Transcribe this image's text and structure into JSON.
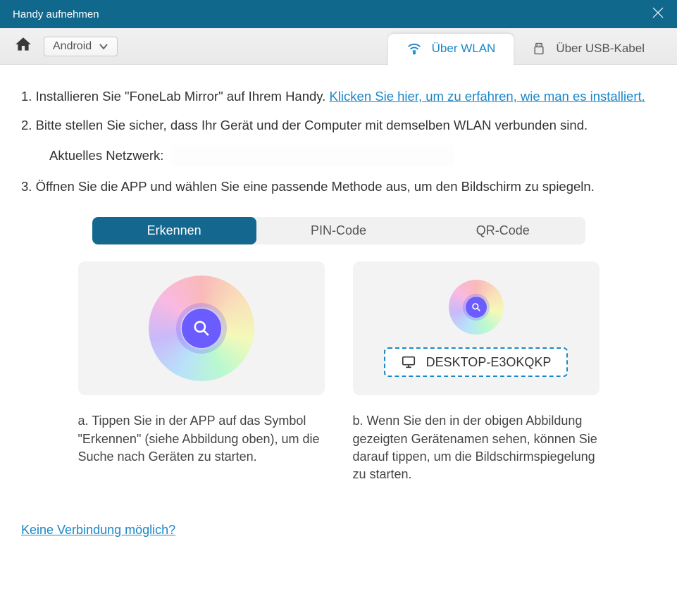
{
  "titlebar": {
    "title": "Handy aufnehmen"
  },
  "platform": {
    "selected": "Android"
  },
  "conn_tabs": {
    "wlan": "Über WLAN",
    "usb": "Über USB-Kabel"
  },
  "instructions": {
    "step1_prefix": "1. Installieren Sie \"FoneLab Mirror\" auf Ihrem Handy. ",
    "step1_link": "Klicken Sie hier, um zu erfahren, wie man es installiert.",
    "step2": "2. Bitte stellen Sie sicher, dass Ihr Gerät und der Computer mit demselben WLAN verbunden sind.",
    "network_label": "Aktuelles Netzwerk:",
    "step3": "3. Öffnen Sie die APP und wählen Sie eine passende Methode aus, um den Bildschirm zu spiegeln."
  },
  "method_tabs": {
    "detect": "Erkennen",
    "pin": "PIN-Code",
    "qr": "QR-Code"
  },
  "panel_a": {
    "desc": "a. Tippen Sie in der APP auf das Symbol \"Erkennen\" (siehe Abbildung oben), um die Suche nach Geräten zu starten."
  },
  "panel_b": {
    "device_name": "DESKTOP-E3OKQKP",
    "desc": "b. Wenn Sie den in der obigen Abbildung gezeigten Gerätenamen sehen, können Sie darauf tippen, um die Bildschirmspiegelung zu starten."
  },
  "footer": {
    "no_connection": "Keine Verbindung möglich?"
  }
}
